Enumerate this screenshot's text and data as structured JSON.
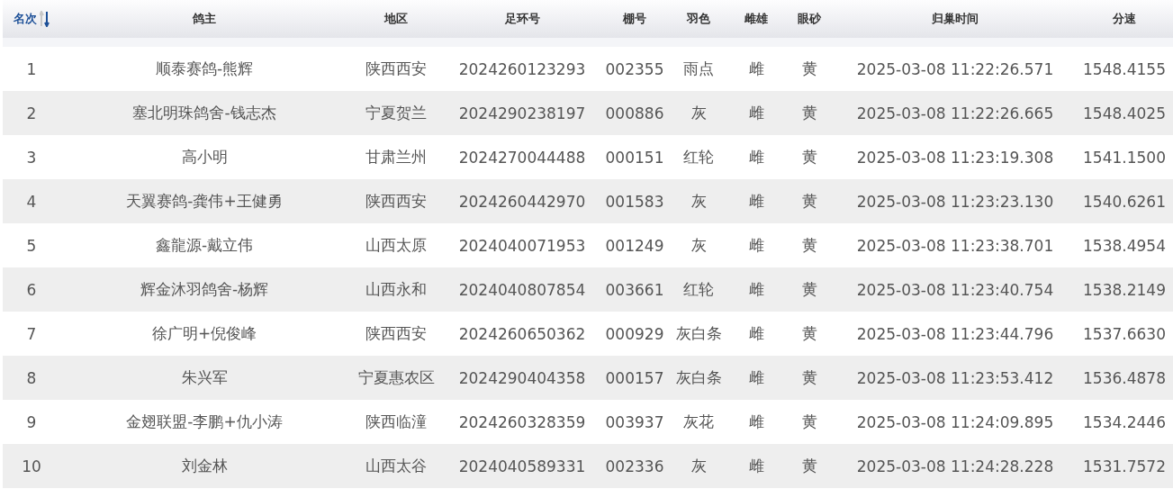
{
  "table": {
    "columns": [
      {
        "label": "名次",
        "kind": "sortable",
        "descending": true
      },
      {
        "label": "鸽主",
        "kind": "plain"
      },
      {
        "label": "地区",
        "kind": "plain"
      },
      {
        "label": "足环号",
        "kind": "plain"
      },
      {
        "label": "棚号",
        "kind": "plain"
      },
      {
        "label": "羽色",
        "kind": "plain"
      },
      {
        "label": "雌雄",
        "kind": "plain"
      },
      {
        "label": "眼砂",
        "kind": "plain"
      },
      {
        "label": "归巢时间",
        "kind": "plain"
      },
      {
        "label": "分速",
        "kind": "plain"
      }
    ],
    "rows": [
      [
        "1",
        "顺泰赛鸽-熊辉",
        "陕西西安",
        "2024260123293",
        "002355",
        "雨点",
        "雌",
        "黄",
        "2025-03-08 11:22:26.571",
        "1548.4155"
      ],
      [
        "2",
        "塞北明珠鸽舍-钱志杰",
        "宁夏贺兰",
        "2024290238197",
        "000886",
        "灰",
        "雌",
        "黄",
        "2025-03-08 11:22:26.665",
        "1548.4025"
      ],
      [
        "3",
        "高小明",
        "甘肃兰州",
        "2024270044488",
        "000151",
        "红轮",
        "雌",
        "黄",
        "2025-03-08 11:23:19.308",
        "1541.1500"
      ],
      [
        "4",
        "天翼赛鸽-龚伟+王健勇",
        "陕西西安",
        "2024260442970",
        "001583",
        "灰",
        "雌",
        "黄",
        "2025-03-08 11:23:23.130",
        "1540.6261"
      ],
      [
        "5",
        "鑫龍源-戴立伟",
        "山西太原",
        "2024040071953",
        "001249",
        "灰",
        "雌",
        "黄",
        "2025-03-08 11:23:38.701",
        "1538.4954"
      ],
      [
        "6",
        "辉金沐羽鸽舍-杨辉",
        "山西永和",
        "2024040807854",
        "003661",
        "红轮",
        "雌",
        "黄",
        "2025-03-08 11:23:40.754",
        "1538.2149"
      ],
      [
        "7",
        "徐广明+倪俊峰",
        "陕西西安",
        "2024260650362",
        "000929",
        "灰白条",
        "雌",
        "黄",
        "2025-03-08 11:23:44.796",
        "1537.6630"
      ],
      [
        "8",
        "朱兴军",
        "宁夏惠农区",
        "2024290404358",
        "000157",
        "灰白条",
        "雌",
        "黄",
        "2025-03-08 11:23:53.412",
        "1536.4878"
      ],
      [
        "9",
        "金翅联盟-李鹏+仇小涛",
        "陕西临潼",
        "2024260328359",
        "003937",
        "灰花",
        "雌",
        "黄",
        "2025-03-08 11:24:09.895",
        "1534.2446"
      ],
      [
        "10",
        "刘金林",
        "山西太谷",
        "2024040589331",
        "002336",
        "灰",
        "雌",
        "黄",
        "2025-03-08 11:24:28.228",
        "1531.7572"
      ]
    ]
  }
}
